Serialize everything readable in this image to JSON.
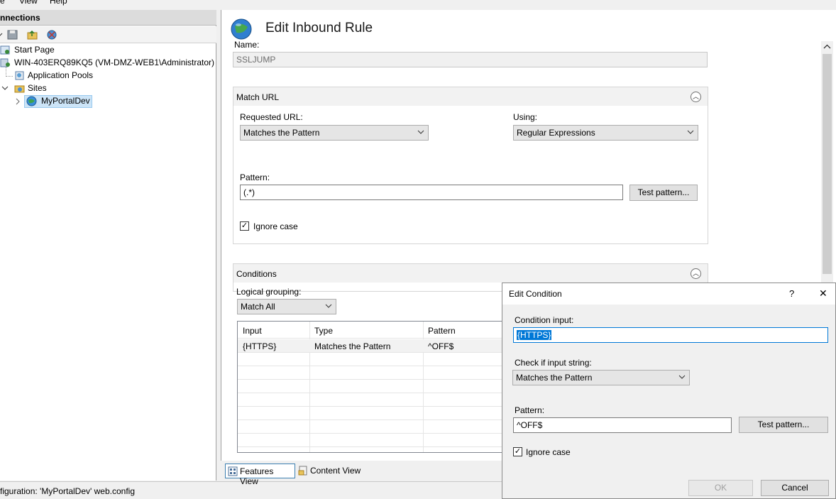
{
  "menu": {
    "items": [
      "e",
      "View",
      "Help"
    ]
  },
  "connections": {
    "header": "nnections",
    "tree": [
      {
        "label": "Start Page"
      },
      {
        "label": "WIN-403ERQ89KQ5 (VM-DMZ-WEB1\\Administrator)"
      },
      {
        "label": "Application Pools"
      },
      {
        "label": "Sites"
      },
      {
        "label": "MyPortalDev"
      }
    ]
  },
  "status": {
    "text": "figuration: 'MyPortalDev' web.config"
  },
  "page": {
    "title": "Edit Inbound Rule",
    "name_label": "Name:",
    "name_value": "SSLJUMP"
  },
  "match_url": {
    "header": "Match URL",
    "requested_label": "Requested URL:",
    "requested_value": "Matches the Pattern",
    "using_label": "Using:",
    "using_value": "Regular Expressions",
    "pattern_label": "Pattern:",
    "pattern_value": "(.*)",
    "test_button": "Test pattern...",
    "ignore_case_label": "Ignore case",
    "ignore_case_checked": true
  },
  "conditions": {
    "header": "Conditions",
    "grouping_label": "Logical grouping:",
    "grouping_value": "Match All",
    "columns": [
      "Input",
      "Type",
      "Pattern"
    ],
    "rows": [
      {
        "input": "{HTTPS}",
        "type": "Matches the Pattern",
        "pattern": "^OFF$"
      }
    ]
  },
  "tabs": {
    "features": "Features View",
    "content": "Content View"
  },
  "dialog": {
    "title": "Edit Condition",
    "help": "?",
    "close": "✕",
    "condition_input_label": "Condition input:",
    "condition_input_value": "{HTTPS}",
    "check_label": "Check if input string:",
    "check_value": "Matches the Pattern",
    "pattern_label": "Pattern:",
    "pattern_value": "^OFF$",
    "test_button": "Test pattern...",
    "ignore_case_label": "Ignore case",
    "ok_button": "OK",
    "cancel_button": "Cancel"
  },
  "colors": {
    "selection": "#0078d7",
    "tree_selection": "#cce4f7",
    "accent_border": "#3c7fb1"
  }
}
